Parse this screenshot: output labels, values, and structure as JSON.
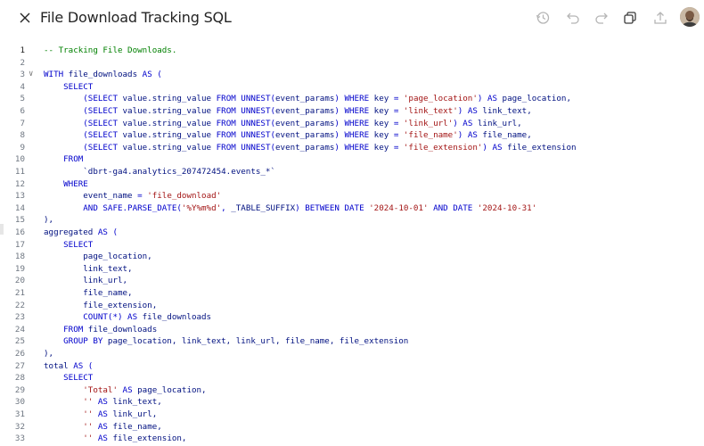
{
  "header": {
    "title": "File Download Tracking SQL",
    "close_icon": "close-icon",
    "toolbar_icons": [
      "history-icon",
      "undo-icon",
      "redo-icon",
      "copy-icon",
      "share-icon"
    ]
  },
  "editor": {
    "active_line": "1",
    "lines": [
      {
        "n": "1",
        "tokens": [
          {
            "t": "-- Tracking File Downloads.",
            "c": "c"
          }
        ]
      },
      {
        "n": "2",
        "tokens": []
      },
      {
        "n": "3",
        "fold": true,
        "tokens": [
          {
            "t": "WITH ",
            "c": "k"
          },
          {
            "t": "file_downloads",
            "c": "i"
          },
          {
            "t": " AS (",
            "c": "k"
          }
        ]
      },
      {
        "n": "4",
        "tokens": [
          {
            "t": "    SELECT",
            "c": "k"
          }
        ]
      },
      {
        "n": "5",
        "tokens": [
          {
            "t": "        (SELECT ",
            "c": "k"
          },
          {
            "t": "value.string_value",
            "c": "i"
          },
          {
            "t": " FROM UNNEST(",
            "c": "k"
          },
          {
            "t": "event_params",
            "c": "i"
          },
          {
            "t": ") WHERE ",
            "c": "k"
          },
          {
            "t": "key",
            "c": "i"
          },
          {
            "t": " = ",
            "c": "k"
          },
          {
            "t": "'page_location'",
            "c": "s"
          },
          {
            "t": ") AS ",
            "c": "k"
          },
          {
            "t": "page_location,",
            "c": "i"
          }
        ]
      },
      {
        "n": "6",
        "tokens": [
          {
            "t": "        (SELECT ",
            "c": "k"
          },
          {
            "t": "value.string_value",
            "c": "i"
          },
          {
            "t": " FROM UNNEST(",
            "c": "k"
          },
          {
            "t": "event_params",
            "c": "i"
          },
          {
            "t": ") WHERE ",
            "c": "k"
          },
          {
            "t": "key",
            "c": "i"
          },
          {
            "t": " = ",
            "c": "k"
          },
          {
            "t": "'link_text'",
            "c": "s"
          },
          {
            "t": ") AS ",
            "c": "k"
          },
          {
            "t": "link_text,",
            "c": "i"
          }
        ]
      },
      {
        "n": "7",
        "tokens": [
          {
            "t": "        (SELECT ",
            "c": "k"
          },
          {
            "t": "value.string_value",
            "c": "i"
          },
          {
            "t": " FROM UNNEST(",
            "c": "k"
          },
          {
            "t": "event_params",
            "c": "i"
          },
          {
            "t": ") WHERE ",
            "c": "k"
          },
          {
            "t": "key",
            "c": "i"
          },
          {
            "t": " = ",
            "c": "k"
          },
          {
            "t": "'link_url'",
            "c": "s"
          },
          {
            "t": ") AS ",
            "c": "k"
          },
          {
            "t": "link_url,",
            "c": "i"
          }
        ]
      },
      {
        "n": "8",
        "tokens": [
          {
            "t": "        (SELECT ",
            "c": "k"
          },
          {
            "t": "value.string_value",
            "c": "i"
          },
          {
            "t": " FROM UNNEST(",
            "c": "k"
          },
          {
            "t": "event_params",
            "c": "i"
          },
          {
            "t": ") WHERE ",
            "c": "k"
          },
          {
            "t": "key",
            "c": "i"
          },
          {
            "t": " = ",
            "c": "k"
          },
          {
            "t": "'file_name'",
            "c": "s"
          },
          {
            "t": ") AS ",
            "c": "k"
          },
          {
            "t": "file_name,",
            "c": "i"
          }
        ]
      },
      {
        "n": "9",
        "tokens": [
          {
            "t": "        (SELECT ",
            "c": "k"
          },
          {
            "t": "value.string_value",
            "c": "i"
          },
          {
            "t": " FROM UNNEST(",
            "c": "k"
          },
          {
            "t": "event_params",
            "c": "i"
          },
          {
            "t": ") WHERE ",
            "c": "k"
          },
          {
            "t": "key",
            "c": "i"
          },
          {
            "t": " = ",
            "c": "k"
          },
          {
            "t": "'file_extension'",
            "c": "s"
          },
          {
            "t": ") AS ",
            "c": "k"
          },
          {
            "t": "file_extension",
            "c": "i"
          }
        ]
      },
      {
        "n": "10",
        "tokens": [
          {
            "t": "    FROM",
            "c": "k"
          }
        ]
      },
      {
        "n": "11",
        "tokens": [
          {
            "t": "        `dbrt-ga4.analytics_207472454.events_*`",
            "c": "i"
          }
        ]
      },
      {
        "n": "12",
        "tokens": [
          {
            "t": "    WHERE",
            "c": "k"
          }
        ]
      },
      {
        "n": "13",
        "tokens": [
          {
            "t": "        event_name",
            "c": "i"
          },
          {
            "t": " = ",
            "c": "k"
          },
          {
            "t": "'file_download'",
            "c": "s"
          }
        ]
      },
      {
        "n": "14",
        "tokens": [
          {
            "t": "        AND SAFE.PARSE_DATE(",
            "c": "k"
          },
          {
            "t": "'%Y%m%d'",
            "c": "s"
          },
          {
            "t": ", ",
            "c": "k"
          },
          {
            "t": "_TABLE_SUFFIX",
            "c": "i"
          },
          {
            "t": ") BETWEEN DATE ",
            "c": "k"
          },
          {
            "t": "'2024-10-01'",
            "c": "s"
          },
          {
            "t": " AND DATE ",
            "c": "k"
          },
          {
            "t": "'2024-10-31'",
            "c": "s"
          }
        ]
      },
      {
        "n": "15",
        "tokens": [
          {
            "t": "),",
            "c": "i"
          }
        ]
      },
      {
        "n": "16",
        "tokens": [
          {
            "t": "aggregated",
            "c": "i"
          },
          {
            "t": " AS (",
            "c": "k"
          }
        ]
      },
      {
        "n": "17",
        "tokens": [
          {
            "t": "    SELECT",
            "c": "k"
          }
        ]
      },
      {
        "n": "18",
        "tokens": [
          {
            "t": "        page_location,",
            "c": "i"
          }
        ]
      },
      {
        "n": "19",
        "tokens": [
          {
            "t": "        link_text,",
            "c": "i"
          }
        ]
      },
      {
        "n": "20",
        "tokens": [
          {
            "t": "        link_url,",
            "c": "i"
          }
        ]
      },
      {
        "n": "21",
        "tokens": [
          {
            "t": "        file_name,",
            "c": "i"
          }
        ]
      },
      {
        "n": "22",
        "tokens": [
          {
            "t": "        file_extension,",
            "c": "i"
          }
        ]
      },
      {
        "n": "23",
        "tokens": [
          {
            "t": "        COUNT(*) AS ",
            "c": "k"
          },
          {
            "t": "file_downloads",
            "c": "i"
          }
        ]
      },
      {
        "n": "24",
        "tokens": [
          {
            "t": "    FROM ",
            "c": "k"
          },
          {
            "t": "file_downloads",
            "c": "i"
          }
        ]
      },
      {
        "n": "25",
        "tokens": [
          {
            "t": "    GROUP BY ",
            "c": "k"
          },
          {
            "t": "page_location, link_text, link_url, file_name, file_extension",
            "c": "i"
          }
        ]
      },
      {
        "n": "26",
        "tokens": [
          {
            "t": "),",
            "c": "i"
          }
        ]
      },
      {
        "n": "27",
        "tokens": [
          {
            "t": "total",
            "c": "i"
          },
          {
            "t": " AS (",
            "c": "k"
          }
        ]
      },
      {
        "n": "28",
        "tokens": [
          {
            "t": "    SELECT",
            "c": "k"
          }
        ]
      },
      {
        "n": "29",
        "tokens": [
          {
            "t": "        ",
            "c": "i"
          },
          {
            "t": "'Total'",
            "c": "s"
          },
          {
            "t": " AS ",
            "c": "k"
          },
          {
            "t": "page_location,",
            "c": "i"
          }
        ]
      },
      {
        "n": "30",
        "tokens": [
          {
            "t": "        ",
            "c": "i"
          },
          {
            "t": "''",
            "c": "s"
          },
          {
            "t": " AS ",
            "c": "k"
          },
          {
            "t": "link_text,",
            "c": "i"
          }
        ]
      },
      {
        "n": "31",
        "tokens": [
          {
            "t": "        ",
            "c": "i"
          },
          {
            "t": "''",
            "c": "s"
          },
          {
            "t": " AS ",
            "c": "k"
          },
          {
            "t": "link_url,",
            "c": "i"
          }
        ]
      },
      {
        "n": "32",
        "tokens": [
          {
            "t": "        ",
            "c": "i"
          },
          {
            "t": "''",
            "c": "s"
          },
          {
            "t": " AS ",
            "c": "k"
          },
          {
            "t": "file_name,",
            "c": "i"
          }
        ]
      },
      {
        "n": "33",
        "tokens": [
          {
            "t": "        ",
            "c": "i"
          },
          {
            "t": "''",
            "c": "s"
          },
          {
            "t": " AS ",
            "c": "k"
          },
          {
            "t": "file_extension,",
            "c": "i"
          }
        ]
      }
    ]
  },
  "colors": {
    "keyword": "#0000cc",
    "string": "#a31515",
    "comment": "#008000",
    "identifier": "#001080",
    "line_number": "#6e7681"
  }
}
